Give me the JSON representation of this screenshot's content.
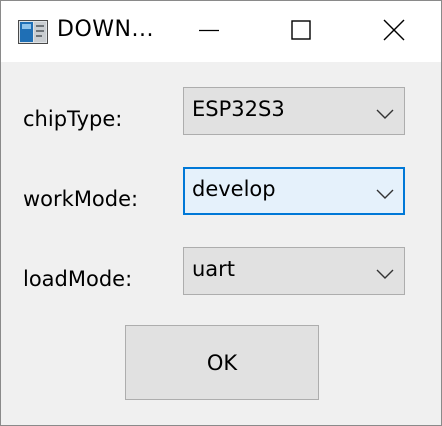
{
  "window": {
    "title": "DOWN...",
    "controls": {
      "minimize": "minimize-icon",
      "maximize": "maximize-icon",
      "close": "close-icon"
    }
  },
  "form": {
    "chip_type": {
      "label": "chipType:",
      "value": "ESP32S3"
    },
    "work_mode": {
      "label": "workMode:",
      "value": "develop"
    },
    "load_mode": {
      "label": "loadMode:",
      "value": "uart"
    }
  },
  "actions": {
    "ok_label": "OK"
  },
  "colors": {
    "focus_border": "#0078d7",
    "focus_fill": "#e5f1fb",
    "control_fill": "#e1e1e1",
    "dialog_bg": "#f0f0f0"
  }
}
